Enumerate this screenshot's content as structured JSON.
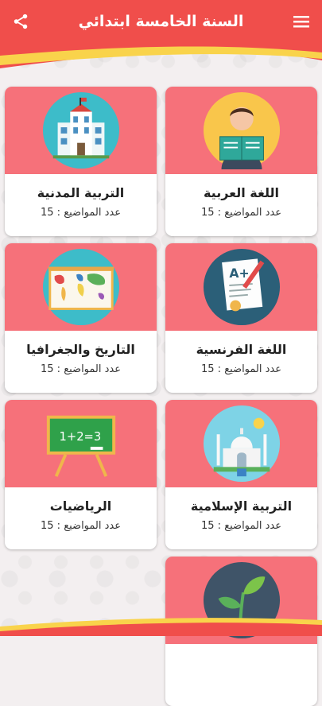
{
  "appbar": {
    "title": "السنة الخامسة ابتدائي",
    "menu_icon": "hamburger-menu-icon",
    "share_icon": "share-icon"
  },
  "colors": {
    "primary": "#f04e4b",
    "card_header": "#f6717a",
    "yellow": "#f9d34b"
  },
  "subjects": [
    {
      "title": "اللغة العربية",
      "count_label": "عدد المواضيع : 15",
      "icon": "reading-student-icon"
    },
    {
      "title": "التربية المدنية",
      "count_label": "عدد المواضيع : 15",
      "icon": "building-icon"
    },
    {
      "title": "اللغة الفرنسية",
      "count_label": "عدد المواضيع : 15",
      "icon": "graded-paper-icon"
    },
    {
      "title": "التاريخ والجغرافيا",
      "count_label": "عدد المواضيع : 15",
      "icon": "world-map-icon"
    },
    {
      "title": "التربية الإسلامية",
      "count_label": "عدد المواضيع : 15",
      "icon": "mosque-icon"
    },
    {
      "title": "الرياضيات",
      "count_label": "عدد المواضيع : 15",
      "icon": "chalkboard-icon"
    },
    {
      "title": "",
      "count_label": "",
      "icon": "plant-sprout-icon"
    }
  ],
  "math_board_text": "1+2=3"
}
